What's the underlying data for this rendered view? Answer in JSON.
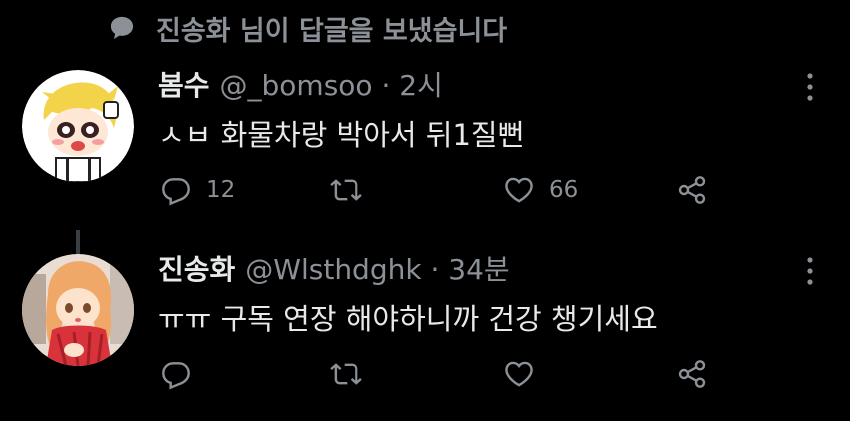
{
  "context": {
    "text": "진송화 님이 답글을 보냈습니다"
  },
  "tweets": [
    {
      "name": "봄수",
      "handle": "@_bomsoo · 2시",
      "body": "ㅅㅂ 화물차랑 박아서 뒤1질뻔",
      "replies": "12",
      "retweets": "",
      "likes": "66"
    },
    {
      "name": "진송화",
      "handle": "@Wlsthdghk · 34분",
      "body": "ㅠㅠ 구독 연장 해야하니까 건강 챙기세요",
      "replies": "",
      "retweets": "",
      "likes": ""
    }
  ],
  "colors": {
    "background": "#000000",
    "secondary": "#8b9196",
    "primary": "#e7e9ea"
  },
  "icons": [
    "speech-bubble-icon",
    "reply-icon",
    "retweet-icon",
    "like-icon",
    "share-icon",
    "more-options-icon"
  ]
}
